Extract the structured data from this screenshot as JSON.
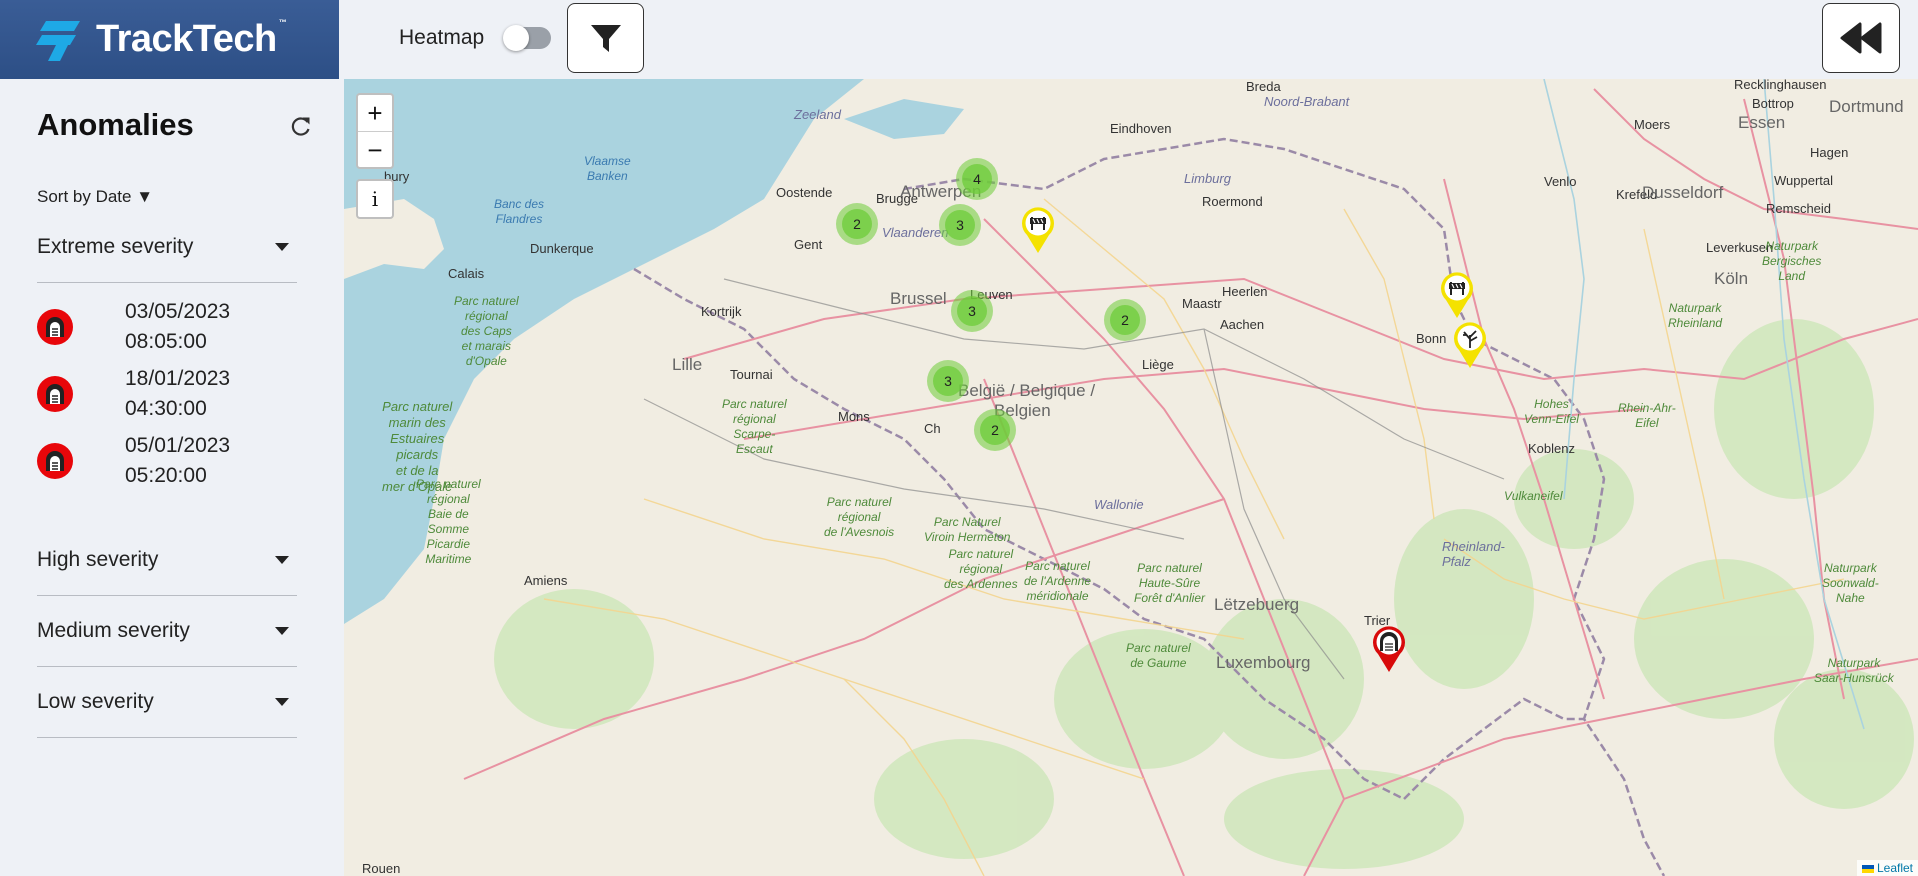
{
  "app": {
    "name": "TrackTech",
    "trademark": "™"
  },
  "toolbar": {
    "heatmap_label": "Heatmap",
    "heatmap_enabled": false,
    "filter_icon": "filter-icon",
    "collapse_icon": "double-chevron-left-icon"
  },
  "sidebar": {
    "title": "Anomalies",
    "refresh_icon": "refresh-icon",
    "sort_label": "Sort by Date ▼",
    "groups": [
      {
        "label": "Extreme severity",
        "expanded": true
      },
      {
        "label": "High severity",
        "expanded": false
      },
      {
        "label": "Medium severity",
        "expanded": false
      },
      {
        "label": "Low severity",
        "expanded": false
      }
    ],
    "extreme_items": [
      {
        "date": "03/05/2023",
        "time": "08:05:00",
        "icon": "tunnel-icon"
      },
      {
        "date": "18/01/2023",
        "time": "04:30:00",
        "icon": "tunnel-icon"
      },
      {
        "date": "05/01/2023",
        "time": "05:20:00",
        "icon": "tunnel-icon"
      }
    ]
  },
  "map": {
    "zoom_in": "+",
    "zoom_out": "−",
    "info": "i",
    "attribution": "Leaflet",
    "clusters": [
      "4",
      "2",
      "3",
      "3",
      "2",
      "3",
      "2"
    ],
    "markers": [
      {
        "type": "barrier-icon",
        "severity": "medium",
        "color": "#f4e200"
      },
      {
        "type": "barrier-icon",
        "severity": "medium",
        "color": "#f4e200"
      },
      {
        "type": "tree-icon",
        "severity": "medium",
        "color": "#f4e200"
      },
      {
        "type": "tunnel-icon",
        "severity": "extreme",
        "color": "#d80a0a"
      }
    ],
    "labels": {
      "breda": "Breda",
      "noord_brabant": "Noord-Brabant",
      "zeeland": "Zeeland",
      "eindhoven": "Eindhoven",
      "venlo": "Venlo",
      "krefeld": "Krefeld",
      "recklinghausen": "Recklinghausen",
      "bottrop": "Bottrop",
      "dortmund": "Dortmund",
      "moers": "Moers",
      "essen": "Essen",
      "hagen": "Hagen",
      "wuppertal": "Wuppertal",
      "limburg": "Limburg",
      "roermond": "Roermond",
      "dusseldorf": "Dusseldorf",
      "remscheid": "Remscheid",
      "leverkusen": "Leverkusen",
      "koln": "Köln",
      "vlaamse_banken": "Vlaamse\nBanken",
      "oostende": "Oostende",
      "brugge": "Brugge",
      "antwerpen": "Antwerpen",
      "gent": "Gent",
      "vlaanderen": "Vlaanderen",
      "banc_des_flandres": "Banc des\nFlandres",
      "dunkerque": "Dunkerque",
      "calais": "Calais",
      "bury": "bury",
      "brussel": "Brussel",
      "leuven": "Leuven",
      "maastricht": "Maastr",
      "heerlen": "Heerlen",
      "aachen": "Aachen",
      "liege": "Liège",
      "kortrijk": "Kortrijk",
      "lille": "Lille",
      "tournai": "Tournai",
      "mons": "Mons",
      "charleroi": "Ch",
      "belgique": "België / Belgique /",
      "belgien": "Belgien",
      "bonn": "Bonn",
      "koblenz": "Koblenz",
      "wallonie": "Wallonie",
      "trier": "Trier",
      "letzebuerg": "Lëtzebuerg",
      "luxembourg": "Luxembourg",
      "amiens": "Amiens",
      "rouen": "Rouen",
      "rheinland_pfalz": "Rheinland-\nPfalz",
      "p_caps": "Parc naturel\nrégional\ndes Caps\net marais\nd'Opale",
      "p_estuaires": "Parc naturel\nmarin des\nEstuaires\npicards\net de la\nmer d'Opale",
      "p_scarpe": "Parc naturel\nrégional\nScarpe-\nEscaut",
      "p_baie": "Parc naturel\nrégional\nBaie de\nSomme\nPicardie\nMaritime",
      "p_avesnois": "Parc naturel\nrégional\nde l'Avesnois",
      "p_viroin": "Parc Naturel\nViroin Hermeton",
      "p_ardennes": "Parc naturel\nrégional\ndes Ardennes",
      "p_ardenne_merid": "Parc naturel\nde l'Ardenne\nméridionale",
      "p_haute_sure": "Parc naturel\nHaute-Sûre\nForêt d'Anlier",
      "p_gaume": "Parc naturel\nde Gaume",
      "p_bergisches": "Naturpark\nBergisches\nLand",
      "p_rheinland": "Naturpark\nRheinland",
      "p_venn": "Hohes\nVenn-Eifel",
      "p_rhein_ahr": "Rhein-Ahr-\nEifel",
      "p_vulkaneifel": "Vulkaneifel",
      "p_soonwald": "Naturpark\nSoonwald-\nNahe",
      "p_saar": "Naturpark\nSaar-Hunsrück"
    }
  }
}
